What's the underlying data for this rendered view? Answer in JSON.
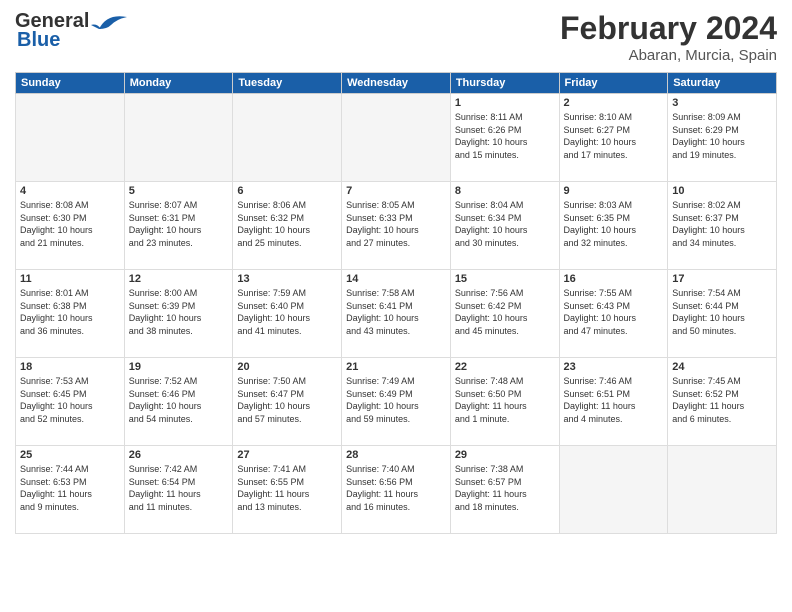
{
  "header": {
    "logo_line1": "General",
    "logo_line2": "Blue",
    "month": "February 2024",
    "location": "Abaran, Murcia, Spain"
  },
  "days_of_week": [
    "Sunday",
    "Monday",
    "Tuesday",
    "Wednesday",
    "Thursday",
    "Friday",
    "Saturday"
  ],
  "weeks": [
    [
      {
        "day": "",
        "info": ""
      },
      {
        "day": "",
        "info": ""
      },
      {
        "day": "",
        "info": ""
      },
      {
        "day": "",
        "info": ""
      },
      {
        "day": "1",
        "info": "Sunrise: 8:11 AM\nSunset: 6:26 PM\nDaylight: 10 hours\nand 15 minutes."
      },
      {
        "day": "2",
        "info": "Sunrise: 8:10 AM\nSunset: 6:27 PM\nDaylight: 10 hours\nand 17 minutes."
      },
      {
        "day": "3",
        "info": "Sunrise: 8:09 AM\nSunset: 6:29 PM\nDaylight: 10 hours\nand 19 minutes."
      }
    ],
    [
      {
        "day": "4",
        "info": "Sunrise: 8:08 AM\nSunset: 6:30 PM\nDaylight: 10 hours\nand 21 minutes."
      },
      {
        "day": "5",
        "info": "Sunrise: 8:07 AM\nSunset: 6:31 PM\nDaylight: 10 hours\nand 23 minutes."
      },
      {
        "day": "6",
        "info": "Sunrise: 8:06 AM\nSunset: 6:32 PM\nDaylight: 10 hours\nand 25 minutes."
      },
      {
        "day": "7",
        "info": "Sunrise: 8:05 AM\nSunset: 6:33 PM\nDaylight: 10 hours\nand 27 minutes."
      },
      {
        "day": "8",
        "info": "Sunrise: 8:04 AM\nSunset: 6:34 PM\nDaylight: 10 hours\nand 30 minutes."
      },
      {
        "day": "9",
        "info": "Sunrise: 8:03 AM\nSunset: 6:35 PM\nDaylight: 10 hours\nand 32 minutes."
      },
      {
        "day": "10",
        "info": "Sunrise: 8:02 AM\nSunset: 6:37 PM\nDaylight: 10 hours\nand 34 minutes."
      }
    ],
    [
      {
        "day": "11",
        "info": "Sunrise: 8:01 AM\nSunset: 6:38 PM\nDaylight: 10 hours\nand 36 minutes."
      },
      {
        "day": "12",
        "info": "Sunrise: 8:00 AM\nSunset: 6:39 PM\nDaylight: 10 hours\nand 38 minutes."
      },
      {
        "day": "13",
        "info": "Sunrise: 7:59 AM\nSunset: 6:40 PM\nDaylight: 10 hours\nand 41 minutes."
      },
      {
        "day": "14",
        "info": "Sunrise: 7:58 AM\nSunset: 6:41 PM\nDaylight: 10 hours\nand 43 minutes."
      },
      {
        "day": "15",
        "info": "Sunrise: 7:56 AM\nSunset: 6:42 PM\nDaylight: 10 hours\nand 45 minutes."
      },
      {
        "day": "16",
        "info": "Sunrise: 7:55 AM\nSunset: 6:43 PM\nDaylight: 10 hours\nand 47 minutes."
      },
      {
        "day": "17",
        "info": "Sunrise: 7:54 AM\nSunset: 6:44 PM\nDaylight: 10 hours\nand 50 minutes."
      }
    ],
    [
      {
        "day": "18",
        "info": "Sunrise: 7:53 AM\nSunset: 6:45 PM\nDaylight: 10 hours\nand 52 minutes."
      },
      {
        "day": "19",
        "info": "Sunrise: 7:52 AM\nSunset: 6:46 PM\nDaylight: 10 hours\nand 54 minutes."
      },
      {
        "day": "20",
        "info": "Sunrise: 7:50 AM\nSunset: 6:47 PM\nDaylight: 10 hours\nand 57 minutes."
      },
      {
        "day": "21",
        "info": "Sunrise: 7:49 AM\nSunset: 6:49 PM\nDaylight: 10 hours\nand 59 minutes."
      },
      {
        "day": "22",
        "info": "Sunrise: 7:48 AM\nSunset: 6:50 PM\nDaylight: 11 hours\nand 1 minute."
      },
      {
        "day": "23",
        "info": "Sunrise: 7:46 AM\nSunset: 6:51 PM\nDaylight: 11 hours\nand 4 minutes."
      },
      {
        "day": "24",
        "info": "Sunrise: 7:45 AM\nSunset: 6:52 PM\nDaylight: 11 hours\nand 6 minutes."
      }
    ],
    [
      {
        "day": "25",
        "info": "Sunrise: 7:44 AM\nSunset: 6:53 PM\nDaylight: 11 hours\nand 9 minutes."
      },
      {
        "day": "26",
        "info": "Sunrise: 7:42 AM\nSunset: 6:54 PM\nDaylight: 11 hours\nand 11 minutes."
      },
      {
        "day": "27",
        "info": "Sunrise: 7:41 AM\nSunset: 6:55 PM\nDaylight: 11 hours\nand 13 minutes."
      },
      {
        "day": "28",
        "info": "Sunrise: 7:40 AM\nSunset: 6:56 PM\nDaylight: 11 hours\nand 16 minutes."
      },
      {
        "day": "29",
        "info": "Sunrise: 7:38 AM\nSunset: 6:57 PM\nDaylight: 11 hours\nand 18 minutes."
      },
      {
        "day": "",
        "info": ""
      },
      {
        "day": "",
        "info": ""
      }
    ]
  ]
}
